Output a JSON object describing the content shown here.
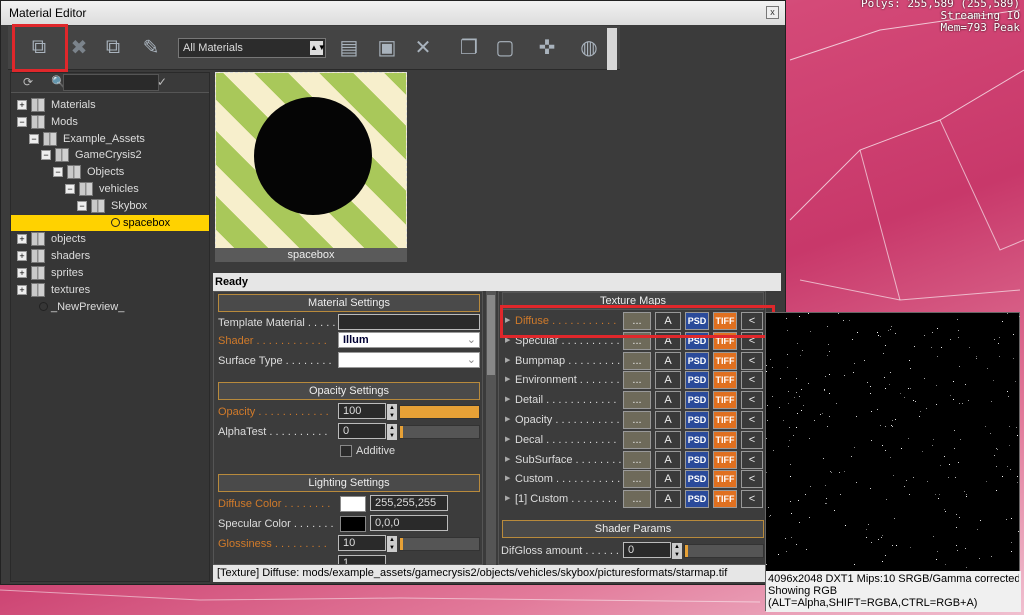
{
  "overlay": {
    "stats": [
      "Polys: 255,589 (255,589)",
      "Streaming IO",
      "Mem=793 Peak"
    ]
  },
  "window": {
    "title": "Material Editor",
    "close": "x"
  },
  "toolbar": {
    "icons": [
      "get-from-selection-icon",
      "remove-icon",
      "assign-to-selection-icon",
      "pick-icon",
      "add-material-icon",
      "save-icon",
      "delete-icon",
      "copy-icon",
      "paste-icon",
      "preview-icon",
      "render-icon"
    ],
    "filter_value": "All Materials"
  },
  "tree": {
    "nodes": [
      {
        "label": "Materials",
        "level": 0,
        "exp": "+"
      },
      {
        "label": "Mods",
        "level": 0,
        "exp": "−"
      },
      {
        "label": "Example_Assets",
        "level": 1,
        "exp": "−"
      },
      {
        "label": "GameCrysis2",
        "level": 2,
        "exp": "−"
      },
      {
        "label": "Objects",
        "level": 3,
        "exp": "−"
      },
      {
        "label": "vehicles",
        "level": 4,
        "exp": "−"
      },
      {
        "label": "Skybox",
        "level": 5,
        "exp": "−"
      },
      {
        "label": "spacebox",
        "level": 6,
        "leaf": true,
        "selected": true
      },
      {
        "label": "objects",
        "level": 0,
        "exp": "+"
      },
      {
        "label": "shaders",
        "level": 0,
        "exp": "+"
      },
      {
        "label": "sprites",
        "level": 0,
        "exp": "+"
      },
      {
        "label": "textures",
        "level": 0,
        "exp": "+"
      },
      {
        "label": "_NewPreview_",
        "level": 0,
        "leaf": true
      }
    ]
  },
  "preview": {
    "caption": "spacebox"
  },
  "status": "Ready",
  "material_settings": {
    "header": "Material Settings",
    "template_label": "Template Material . . . . .",
    "template_value": "",
    "shader_label": "Shader . . . . . . . . . . . .",
    "shader_value": "Illum",
    "surface_label": "Surface Type . . . . . . . .",
    "surface_value": ""
  },
  "opacity_settings": {
    "header": "Opacity Settings",
    "opacity_label": "Opacity . . . . . . . . . . . .",
    "opacity_value": "100",
    "opacity_fraction": 1.0,
    "alphatest_label": "AlphaTest . . . . . . . . . .",
    "alphatest_value": "0",
    "alphatest_fraction": 0.0,
    "additive_label": "Additive"
  },
  "lighting_settings": {
    "header": "Lighting Settings",
    "diffuse_label": "Diffuse Color . . . . . . . .",
    "diffuse_value": "255,255,255",
    "diffuse_color": "#ffffff",
    "specular_label": "Specular Color . . . . . . .",
    "specular_value": "0,0,0",
    "specular_color": "#000000",
    "gloss_label": "Glossiness . . . . . . . . .",
    "gloss_value": "10",
    "gloss_fraction": 0.04,
    "extra_value": "1"
  },
  "texture_maps": {
    "header": "Texture Maps",
    "btn_dots": "...",
    "btn_a": "A",
    "btn_psd": "PSD",
    "btn_tiff": "TIFF",
    "btn_back": "<",
    "rows": [
      {
        "label": "Diffuse . . . . . . . . . . .",
        "active": true
      },
      {
        "label": "Specular . . . . . . . . . ."
      },
      {
        "label": "Bumpmap . . . . . . . . ."
      },
      {
        "label": "Environment . . . . . . ."
      },
      {
        "label": "Detail . . . . . . . . . . . ."
      },
      {
        "label": "Opacity . . . . . . . . . . ."
      },
      {
        "label": "Decal . . . . . . . . . . . ."
      },
      {
        "label": "SubSurface . . . . . . . ."
      },
      {
        "label": "Custom . . . . . . . . . . ."
      },
      {
        "label": "[1] Custom . . . . . . . ."
      }
    ]
  },
  "shader_params": {
    "header": "Shader Params",
    "difgloss_label": "DifGloss amount . . . . . .",
    "difgloss_value": "0"
  },
  "pathbar": "[Texture] Diffuse: mods/example_assets/gamecrysis2/objects/vehicles/skybox/picturesformats/starmap.tif",
  "tooltip": {
    "line1": "4096x2048 DXT1 Mips:10 SRGB/Gamma corrected",
    "line2": "Showing RGB",
    "line3": "(ALT=Alpha,SHIFT=RGBA,CTRL=RGB+A)"
  }
}
